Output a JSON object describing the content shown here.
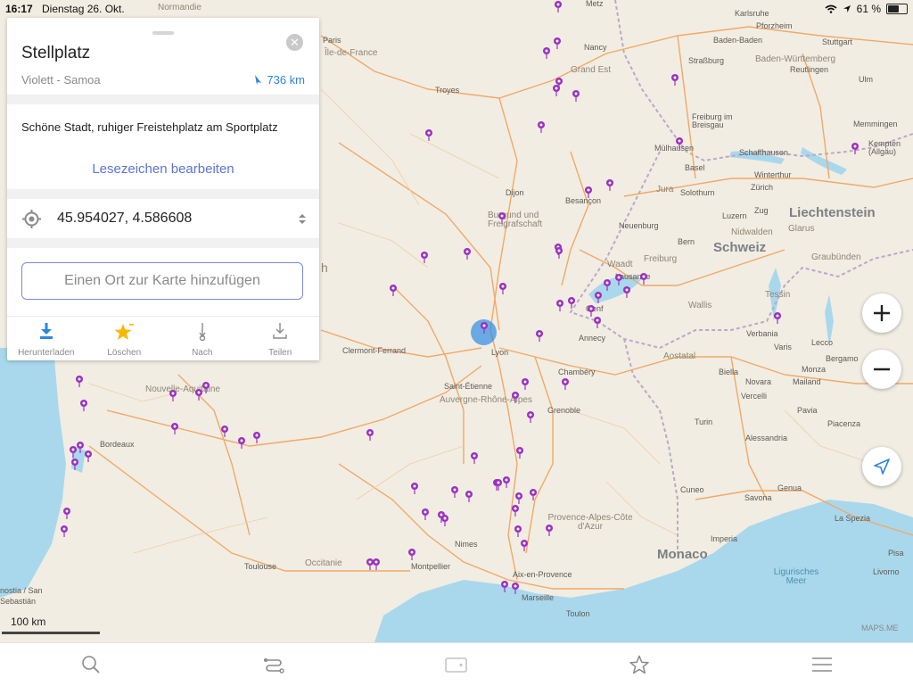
{
  "status": {
    "time": "16:17",
    "date": "Dienstag 26. Okt.",
    "battery": "61 %",
    "battery_level": 0.61
  },
  "card": {
    "title": "Stellplatz",
    "subtitle": "Violett - Samoa",
    "distance": "736 km",
    "description": "Schöne Stadt, ruhiger Freistehplatz am Sportplatz",
    "edit_bookmark": "Lesezeichen bearbeiten",
    "coordinates": "45.954027, 4.586608",
    "add_place": "Einen Ort zur Karte hinzufügen",
    "actions": [
      {
        "label": "Herunterladen",
        "icon": "download-icon"
      },
      {
        "label": "Löschen",
        "icon": "star-icon"
      },
      {
        "label": "Nach",
        "icon": "route-to-icon"
      },
      {
        "label": "Teilen",
        "icon": "share-icon"
      }
    ]
  },
  "map": {
    "scale": "100 km",
    "attribution": "MAPS.ME",
    "labels": [
      {
        "text": "Normandie",
        "kind": "region"
      },
      {
        "text": "Paris",
        "kind": "city"
      },
      {
        "text": "Île-de-France",
        "kind": "region"
      },
      {
        "text": "Troyes",
        "kind": "city"
      },
      {
        "text": "Metz",
        "kind": "city"
      },
      {
        "text": "Nancy",
        "kind": "city"
      },
      {
        "text": "Grand Est",
        "kind": "region"
      },
      {
        "text": "Straßburg",
        "kind": "city"
      },
      {
        "text": "Karlsruhe",
        "kind": "city"
      },
      {
        "text": "Pforzheim",
        "kind": "city"
      },
      {
        "text": "Baden-Baden",
        "kind": "city"
      },
      {
        "text": "Stuttgart",
        "kind": "city"
      },
      {
        "text": "Baden-Württemberg",
        "kind": "region"
      },
      {
        "text": "Reutlingen",
        "kind": "city"
      },
      {
        "text": "Ulm",
        "kind": "city"
      },
      {
        "text": "Freiburg im Breisgau",
        "kind": "city"
      },
      {
        "text": "Memmingen",
        "kind": "city"
      },
      {
        "text": "Kempten (Allgäu)",
        "kind": "city"
      },
      {
        "text": "Mülhausen",
        "kind": "city"
      },
      {
        "text": "Basel",
        "kind": "city"
      },
      {
        "text": "Schaffhausen",
        "kind": "city"
      },
      {
        "text": "Winterthur",
        "kind": "city"
      },
      {
        "text": "Zürich",
        "kind": "city"
      },
      {
        "text": "Jura",
        "kind": "region"
      },
      {
        "text": "Solothurn",
        "kind": "city"
      },
      {
        "text": "Luzern",
        "kind": "city"
      },
      {
        "text": "Zug",
        "kind": "city"
      },
      {
        "text": "Liechtenstein",
        "kind": "country"
      },
      {
        "text": "Glarus",
        "kind": "region"
      },
      {
        "text": "Nidwalden",
        "kind": "region"
      },
      {
        "text": "Schweiz",
        "kind": "country"
      },
      {
        "text": "Graubünden",
        "kind": "region"
      },
      {
        "text": "Dijon",
        "kind": "city"
      },
      {
        "text": "Besançon",
        "kind": "city"
      },
      {
        "text": "Neuenburg",
        "kind": "city"
      },
      {
        "text": "Bern",
        "kind": "city"
      },
      {
        "text": "Burgund und Freigrafschaft",
        "kind": "region"
      },
      {
        "text": "Freiburg",
        "kind": "region"
      },
      {
        "text": "Waadt",
        "kind": "region"
      },
      {
        "text": "Lausanne",
        "kind": "city"
      },
      {
        "text": "Tessin",
        "kind": "region"
      },
      {
        "text": "Genf",
        "kind": "city"
      },
      {
        "text": "Wallis",
        "kind": "region"
      },
      {
        "text": "Annecy",
        "kind": "city"
      },
      {
        "text": "Verbania",
        "kind": "city"
      },
      {
        "text": "Varis",
        "kind": "city"
      },
      {
        "text": "Lecco",
        "kind": "city"
      },
      {
        "text": "Bergamo",
        "kind": "city"
      },
      {
        "text": "Clermont-Ferrand",
        "kind": "city"
      },
      {
        "text": "Lyon",
        "kind": "city"
      },
      {
        "text": "Aostatal",
        "kind": "region"
      },
      {
        "text": "Biella",
        "kind": "city"
      },
      {
        "text": "Monza",
        "kind": "city"
      },
      {
        "text": "Novara",
        "kind": "city"
      },
      {
        "text": "Mailand",
        "kind": "city"
      },
      {
        "text": "Vercelli",
        "kind": "city"
      },
      {
        "text": "Chambéry",
        "kind": "city"
      },
      {
        "text": "Saint-Étienne",
        "kind": "city"
      },
      {
        "text": "Auvergne-Rhône-Alpes",
        "kind": "region"
      },
      {
        "text": "Grenoble",
        "kind": "city"
      },
      {
        "text": "Nouvelle-Aquitaine",
        "kind": "region"
      },
      {
        "text": "Pavia",
        "kind": "city"
      },
      {
        "text": "Turin",
        "kind": "city"
      },
      {
        "text": "Piacenza",
        "kind": "city"
      },
      {
        "text": "Alessandria",
        "kind": "city"
      },
      {
        "text": "Bordeaux",
        "kind": "city"
      },
      {
        "text": "Cuneo",
        "kind": "city"
      },
      {
        "text": "Savona",
        "kind": "city"
      },
      {
        "text": "Genua",
        "kind": "city"
      },
      {
        "text": "La Spezia",
        "kind": "city"
      },
      {
        "text": "Provence-Alpes-Côte d'Azur",
        "kind": "region"
      },
      {
        "text": "Imperia",
        "kind": "city"
      },
      {
        "text": "Nimes",
        "kind": "city"
      },
      {
        "text": "Monaco",
        "kind": "country"
      },
      {
        "text": "Ligurisches Meer",
        "kind": "sea"
      },
      {
        "text": "Toulouse",
        "kind": "city"
      },
      {
        "text": "Occitanie",
        "kind": "region"
      },
      {
        "text": "Montpellier",
        "kind": "city"
      },
      {
        "text": "Aix-en-Provence",
        "kind": "city"
      },
      {
        "text": "Pisa",
        "kind": "city"
      },
      {
        "text": "Livorno",
        "kind": "city"
      },
      {
        "text": "Marseille",
        "kind": "city"
      },
      {
        "text": "Toulon",
        "kind": "city"
      },
      {
        "text": "nostia / San",
        "kind": "city"
      },
      {
        "text": "Sebastián",
        "kind": "city"
      },
      {
        "text": "h",
        "kind": "region"
      }
    ]
  },
  "tabbar": [
    {
      "name": "search-tab",
      "icon": "search-icon"
    },
    {
      "name": "route-tab",
      "icon": "route-icon"
    },
    {
      "name": "discovery-tab",
      "icon": "wallet-icon"
    },
    {
      "name": "bookmarks-tab",
      "icon": "star-outline-icon"
    },
    {
      "name": "menu-tab",
      "icon": "hamburger-icon"
    }
  ],
  "colors": {
    "accent": "#2e86de",
    "link": "#5b74d6",
    "pin": "#9b30c0",
    "water": "#9dd3ea",
    "road": "#f0a060",
    "star": "#f6b800"
  }
}
